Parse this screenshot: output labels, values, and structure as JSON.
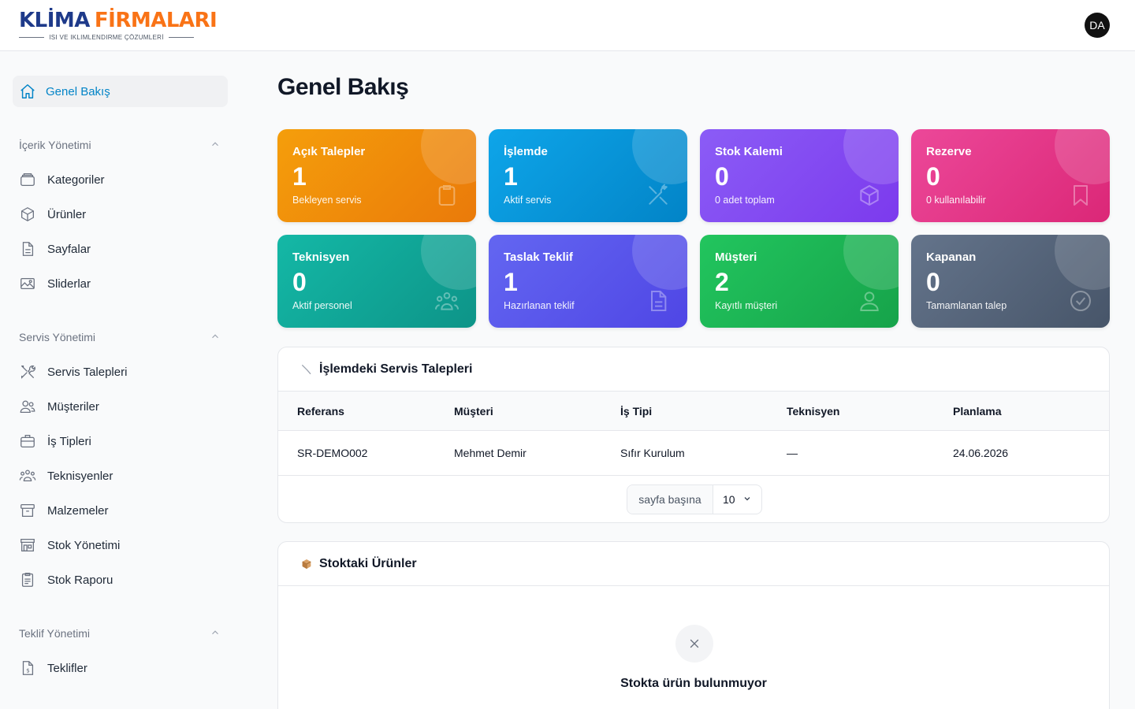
{
  "header": {
    "logo_part1": "KLİMA",
    "logo_part2": "FİRMALARI",
    "logo_tagline": "ISI VE IKLIMLENDIRME ÇÖZUMLERİ",
    "user_initials": "DA"
  },
  "page_title": "Genel Bakış",
  "sidebar": {
    "active": {
      "label": "Genel Bakış",
      "icon": "home-icon"
    },
    "sections": [
      {
        "title": "İçerik Yönetimi",
        "items": [
          {
            "label": "Kategoriler",
            "icon": "folder-icon"
          },
          {
            "label": "Ürünler",
            "icon": "cube-icon"
          },
          {
            "label": "Sayfalar",
            "icon": "document-icon"
          },
          {
            "label": "Sliderlar",
            "icon": "image-icon"
          }
        ]
      },
      {
        "title": "Servis Yönetimi",
        "items": [
          {
            "label": "Servis Talepleri",
            "icon": "tools-icon"
          },
          {
            "label": "Müşteriler",
            "icon": "users-icon"
          },
          {
            "label": "İş Tipleri",
            "icon": "briefcase-icon"
          },
          {
            "label": "Teknisyenler",
            "icon": "team-icon"
          },
          {
            "label": "Malzemeler",
            "icon": "archive-icon"
          },
          {
            "label": "Stok Yönetimi",
            "icon": "store-icon"
          },
          {
            "label": "Stok Raporu",
            "icon": "clipboard-icon"
          }
        ]
      },
      {
        "title": "Teklif Yönetimi",
        "items": [
          {
            "label": "Teklifler",
            "icon": "invoice-icon"
          }
        ]
      }
    ]
  },
  "stats": [
    {
      "title": "Açık Talepler",
      "value": "1",
      "sub": "Bekleyen servis",
      "icon": "clipboard-icon",
      "color_from": "#f59e0b",
      "color_to": "#ea7a0a"
    },
    {
      "title": "İşlemde",
      "value": "1",
      "sub": "Aktif servis",
      "icon": "wrench-icon",
      "color_from": "#0ea5e9",
      "color_to": "#0284c7"
    },
    {
      "title": "Stok Kalemi",
      "value": "0",
      "sub": "0 adet toplam",
      "icon": "cube-icon",
      "color_from": "#8b5cf6",
      "color_to": "#7c3aed"
    },
    {
      "title": "Rezerve",
      "value": "0",
      "sub": "0 kullanılabilir",
      "icon": "bookmark-icon",
      "color_from": "#ec4899",
      "color_to": "#db2777"
    },
    {
      "title": "Teknisyen",
      "value": "0",
      "sub": "Aktif personel",
      "icon": "team-icon",
      "color_from": "#14b8a6",
      "color_to": "#0d9488"
    },
    {
      "title": "Taslak Teklif",
      "value": "1",
      "sub": "Hazırlanan teklif",
      "icon": "document-icon",
      "color_from": "#6366f1",
      "color_to": "#4f46e5"
    },
    {
      "title": "Müşteri",
      "value": "2",
      "sub": "Kayıtlı müşteri",
      "icon": "user-icon",
      "color_from": "#22c55e",
      "color_to": "#16a34a"
    },
    {
      "title": "Kapanan",
      "value": "0",
      "sub": "Tamamlanan talep",
      "icon": "check-circle-icon",
      "color_from": "#64748b",
      "color_to": "#475569"
    }
  ],
  "service_panel": {
    "title": "İşlemdeki Servis Talepleri",
    "columns": [
      "Referans",
      "Müşteri",
      "İş Tipi",
      "Teknisyen",
      "Planlama"
    ],
    "rows": [
      [
        "SR-DEMO002",
        "Mehmet Demir",
        "Sıfır Kurulum",
        "—",
        "24.06.2026"
      ]
    ],
    "per_page_label": "sayfa başına",
    "per_page_value": "10"
  },
  "stock_panel": {
    "title": "Stoktaki Ürünler",
    "empty_text": "Stokta ürün bulunmuyor"
  }
}
